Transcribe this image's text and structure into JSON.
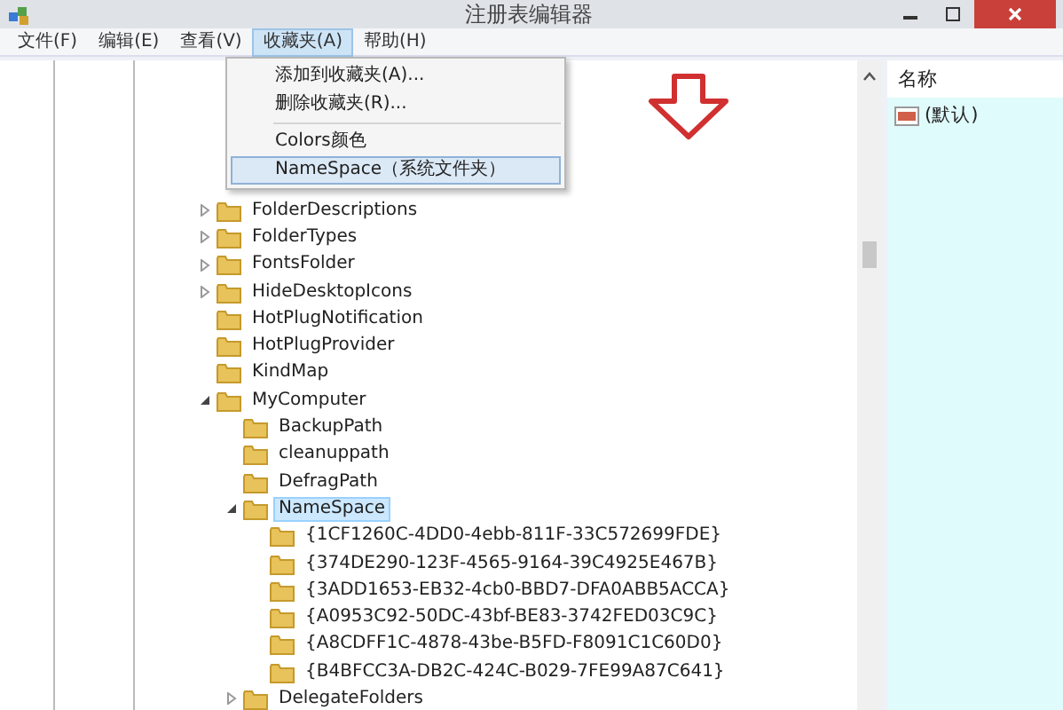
{
  "window": {
    "title": "注册表编辑器"
  },
  "menu_bar": [
    {
      "label": "文件(F)",
      "selected": false
    },
    {
      "label": "编辑(E)",
      "selected": false
    },
    {
      "label": "查看(V)",
      "selected": false
    },
    {
      "label": "收藏夹(A)",
      "selected": true
    },
    {
      "label": "帮助(H)",
      "selected": false
    }
  ],
  "dropdown": [
    {
      "kind": "item",
      "label": "添加到收藏夹(A)...",
      "selected": false
    },
    {
      "kind": "item",
      "label": "删除收藏夹(R)...",
      "selected": false
    },
    {
      "kind": "separator"
    },
    {
      "kind": "item",
      "label": "Colors颜色",
      "selected": false
    },
    {
      "kind": "item",
      "label": "NameSpace（系统文件夹）",
      "selected": true
    }
  ],
  "tree": [
    {
      "label": "FolderDescriptions",
      "expandable": true,
      "expanded": false,
      "selected": false
    },
    {
      "label": "FolderTypes",
      "expandable": true,
      "expanded": false,
      "selected": false
    },
    {
      "label": "FontsFolder",
      "expandable": true,
      "expanded": false,
      "selected": false
    },
    {
      "label": "HideDesktopIcons",
      "expandable": true,
      "expanded": false,
      "selected": false
    },
    {
      "label": "HotPlugNotification",
      "expandable": false,
      "selected": false
    },
    {
      "label": "HotPlugProvider",
      "expandable": false,
      "selected": false
    },
    {
      "label": "KindMap",
      "expandable": false,
      "selected": false
    },
    {
      "label": "MyComputer",
      "expandable": true,
      "expanded": true,
      "selected": false,
      "children": [
        {
          "label": "BackupPath",
          "expandable": false,
          "selected": false
        },
        {
          "label": "cleanuppath",
          "expandable": false,
          "selected": false
        },
        {
          "label": "DefragPath",
          "expandable": false,
          "selected": false
        },
        {
          "label": "NameSpace",
          "expandable": true,
          "expanded": true,
          "selected": true,
          "children": [
            {
              "label": "{1CF1260C-4DD0-4ebb-811F-33C572699FDE}",
              "expandable": false,
              "selected": false
            },
            {
              "label": "{374DE290-123F-4565-9164-39C4925E467B}",
              "expandable": false,
              "selected": false
            },
            {
              "label": "{3ADD1653-EB32-4cb0-BBD7-DFA0ABB5ACCA}",
              "expandable": false,
              "selected": false
            },
            {
              "label": "{A0953C92-50DC-43bf-BE83-3742FED03C9C}",
              "expandable": false,
              "selected": false
            },
            {
              "label": "{A8CDFF1C-4878-43be-B5FD-F8091C1C60D0}",
              "expandable": false,
              "selected": false
            },
            {
              "label": "{B4BFCC3A-DB2C-424C-B029-7FE99A87C641}",
              "expandable": false,
              "selected": false
            }
          ]
        },
        {
          "label": "DelegateFolders",
          "expandable": true,
          "expanded": false,
          "selected": false
        }
      ]
    }
  ],
  "values_pane": {
    "column_header": "名称",
    "rows": [
      {
        "name": "(默认)"
      }
    ]
  }
}
